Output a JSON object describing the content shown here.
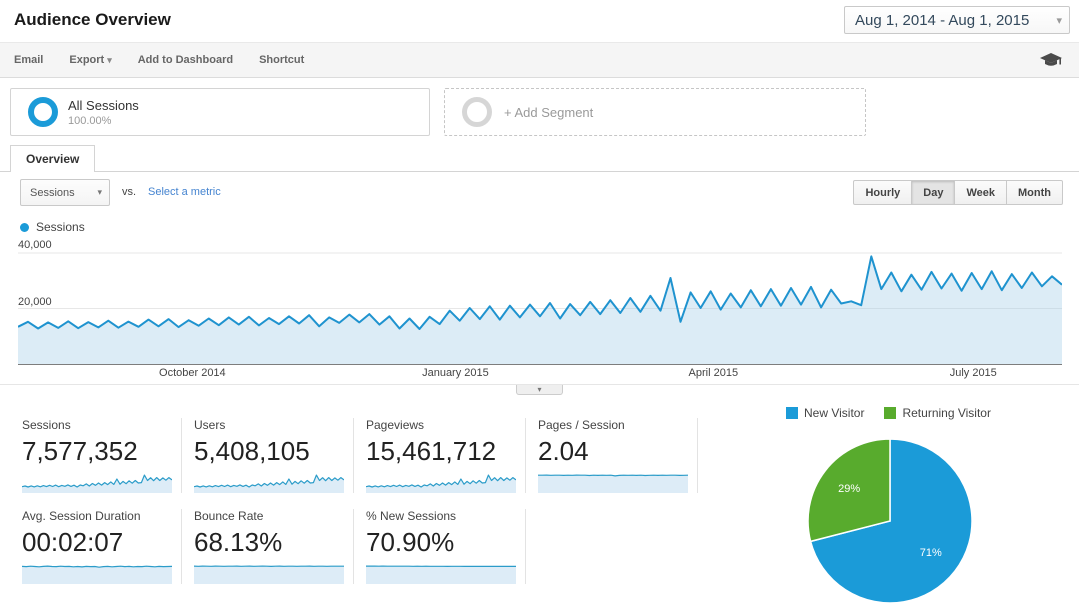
{
  "page": {
    "title": "Audience Overview"
  },
  "date_range": {
    "label": "Aug 1, 2014 - Aug 1, 2015"
  },
  "toolbar": {
    "items": [
      {
        "label": "Email"
      },
      {
        "label": "Export"
      },
      {
        "label": "Add to Dashboard"
      },
      {
        "label": "Shortcut"
      }
    ]
  },
  "segments": {
    "all_sessions": {
      "title": "All Sessions",
      "pct": "100.00%"
    },
    "add_segment": {
      "label": "+ Add Segment"
    }
  },
  "tabs": {
    "overview": "Overview"
  },
  "controls": {
    "metric_select": "Sessions",
    "vs": "vs.",
    "compare_link": "Select a metric",
    "granularity": [
      {
        "label": "Hourly",
        "active": false
      },
      {
        "label": "Day",
        "active": true
      },
      {
        "label": "Week",
        "active": false
      },
      {
        "label": "Month",
        "active": false
      }
    ]
  },
  "legend": {
    "sessions": "Sessions"
  },
  "colors": {
    "accent_blue": "#1b9bd8",
    "line_blue": "#1f93cf",
    "area_fill": "rgba(164,205,231,0.38)",
    "spark_line": "#2b9cc9",
    "spark_fill": "#ddecf7",
    "green": "#58ab2d",
    "grid": "#e7e7e7"
  },
  "metrics": {
    "row1": [
      {
        "label": "Sessions",
        "value": "7,577,352",
        "spark": "trend"
      },
      {
        "label": "Users",
        "value": "5,408,105",
        "spark": "trend"
      },
      {
        "label": "Pageviews",
        "value": "15,461,712",
        "spark": "trend"
      },
      {
        "label": "Pages / Session",
        "value": "2.04",
        "spark": "pages_session"
      }
    ],
    "row2": [
      {
        "label": "Avg. Session Duration",
        "value": "00:02:07",
        "spark": "duration"
      },
      {
        "label": "Bounce Rate",
        "value": "68.13%",
        "spark": "bounce"
      },
      {
        "label": "% New Sessions",
        "value": "70.90%",
        "spark": "new_sessions"
      }
    ]
  },
  "chart_data": {
    "main": {
      "type": "line",
      "title": "Sessions over time",
      "series_name": "Sessions",
      "x_range": [
        "Aug 1, 2014",
        "Aug 1, 2015"
      ],
      "ylim": [
        0,
        44700
      ],
      "y_ticks": [
        40000,
        20000
      ],
      "y_tick_labels": [
        "40,000",
        "20,000"
      ],
      "grid": true,
      "x_ticks": [
        {
          "label": "October 2014",
          "pos": 0.167
        },
        {
          "label": "January 2015",
          "pos": 0.419
        },
        {
          "label": "April 2015",
          "pos": 0.666
        },
        {
          "label": "July 2015",
          "pos": 0.915
        }
      ],
      "values": [
        13400,
        15200,
        12800,
        15000,
        13000,
        15400,
        12900,
        15100,
        13200,
        15600,
        13100,
        15300,
        13400,
        16000,
        13600,
        16200,
        13300,
        15800,
        13800,
        16400,
        14000,
        16800,
        14200,
        17000,
        13900,
        16600,
        14400,
        17200,
        14600,
        17600,
        13600,
        16800,
        14800,
        17800,
        15000,
        18000,
        14200,
        17200,
        12800,
        16400,
        12600,
        17000,
        14400,
        19200,
        15600,
        20200,
        16200,
        20800,
        16000,
        21000,
        16800,
        21400,
        17200,
        22000,
        16400,
        21600,
        17600,
        22400,
        18000,
        23000,
        18400,
        23800,
        18800,
        24600,
        19200,
        31000,
        15200,
        25800,
        20200,
        26200,
        19600,
        25400,
        20400,
        26600,
        20800,
        27000,
        21000,
        27400,
        21400,
        27800,
        20400,
        26800,
        21800,
        22600,
        21200,
        38800,
        27000,
        33000,
        26200,
        32200,
        26800,
        33200,
        27200,
        32600,
        26400,
        32800,
        27000,
        33400,
        26600,
        32400,
        27400,
        33000,
        28000,
        31600,
        28600
      ]
    },
    "sparklines": {
      "trend": [
        13500,
        15000,
        13000,
        15200,
        13200,
        15500,
        13400,
        16000,
        13800,
        16500,
        14000,
        17000,
        13600,
        16300,
        14500,
        17500,
        14200,
        16800,
        13000,
        17200,
        15500,
        19500,
        15000,
        20500,
        16500,
        21500,
        17000,
        22500,
        18000,
        24000,
        18500,
        30200,
        19000,
        25000,
        20000,
        26200,
        21000,
        27000,
        21500,
        22300,
        38600,
        27000,
        33000,
        26500,
        33200,
        27000,
        32600,
        27500,
        33100,
        28200
      ],
      "pages_session": [
        2.06,
        2.05,
        2.07,
        2.04,
        2.06,
        2.05,
        2.03,
        2.06,
        2.04,
        2.07,
        2.05,
        2.06,
        2.02,
        2.05,
        2.03,
        2.06,
        2.04,
        2.05,
        1.97,
        2.03,
        2.05,
        2.04,
        2.06,
        2.03,
        2.05,
        2.02,
        2.04,
        2.06,
        2.03,
        2.05,
        2.04,
        2.06,
        2.05,
        2.03,
        2.04,
        2.05
      ],
      "duration": [
        128,
        126,
        129,
        127,
        125,
        128,
        130,
        127,
        126,
        129,
        127,
        128,
        125,
        127,
        124,
        128,
        126,
        127,
        122,
        126,
        128,
        125,
        127,
        129,
        126,
        128,
        125,
        127,
        126,
        129,
        127,
        125,
        128,
        126,
        127,
        128
      ],
      "bounce": [
        68.5,
        67.9,
        68.4,
        68.1,
        67.8,
        68.6,
        68.2,
        67.7,
        68.3,
        68.0,
        68.5,
        67.9,
        68.2,
        68.4,
        67.8,
        68.1,
        68.6,
        68.0,
        67.5,
        68.2,
        68.4,
        67.9,
        68.1,
        68.3,
        67.8,
        68.2,
        68.0,
        68.4,
        67.9,
        68.1,
        68.3,
        67.8,
        68.2,
        68.0,
        68.3,
        68.1
      ],
      "new_sessions": [
        72.0,
        71.8,
        71.9,
        71.6,
        71.8,
        71.5,
        71.7,
        71.4,
        71.6,
        71.3,
        71.5,
        71.2,
        71.4,
        71.1,
        71.3,
        71.0,
        71.2,
        70.9,
        71.1,
        70.8,
        71.0,
        70.9,
        71.1,
        70.7,
        70.9,
        70.6,
        70.8,
        70.7,
        70.9,
        70.5,
        70.7,
        70.6,
        70.8,
        70.5,
        70.6,
        70.7
      ]
    },
    "pie": {
      "type": "pie",
      "legend": [
        "New Visitor",
        "Returning Visitor"
      ],
      "values": [
        71,
        29
      ],
      "labels": [
        "71%",
        "29%"
      ],
      "colors": [
        "#1b9bd8",
        "#58ab2d"
      ],
      "legend_position": "top"
    }
  }
}
